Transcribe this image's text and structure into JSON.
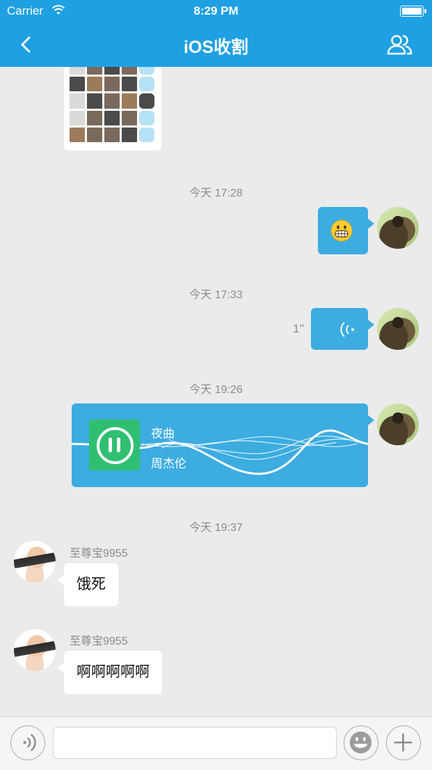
{
  "status_bar": {
    "carrier": "Carrier",
    "time": "8:29 PM"
  },
  "nav": {
    "title": "iOS收割"
  },
  "messages": [
    {
      "type": "image",
      "sender": "other"
    },
    {
      "type": "timestamp",
      "text": "今天  17:28"
    },
    {
      "type": "emoji",
      "sender": "self"
    },
    {
      "type": "timestamp",
      "text": "今天  17:33"
    },
    {
      "type": "voice",
      "sender": "self",
      "duration": "1''"
    },
    {
      "type": "timestamp",
      "text": "今天  19:26"
    },
    {
      "type": "music",
      "sender": "self",
      "title": "夜曲",
      "artist": "周杰伦"
    },
    {
      "type": "timestamp",
      "text": "今天  19:37"
    },
    {
      "type": "text",
      "sender": "other",
      "nickname": "至尊宝9955",
      "text": "饿死"
    },
    {
      "type": "text",
      "sender": "other",
      "nickname": "至尊宝9955",
      "text": "啊啊啊啊啊"
    }
  ],
  "input_bar": {
    "placeholder": ""
  },
  "colors": {
    "brand": "#1fa0e3",
    "bubble_self": "#3cace1",
    "music_button": "#2fbf71",
    "background": "#ebebeb"
  }
}
